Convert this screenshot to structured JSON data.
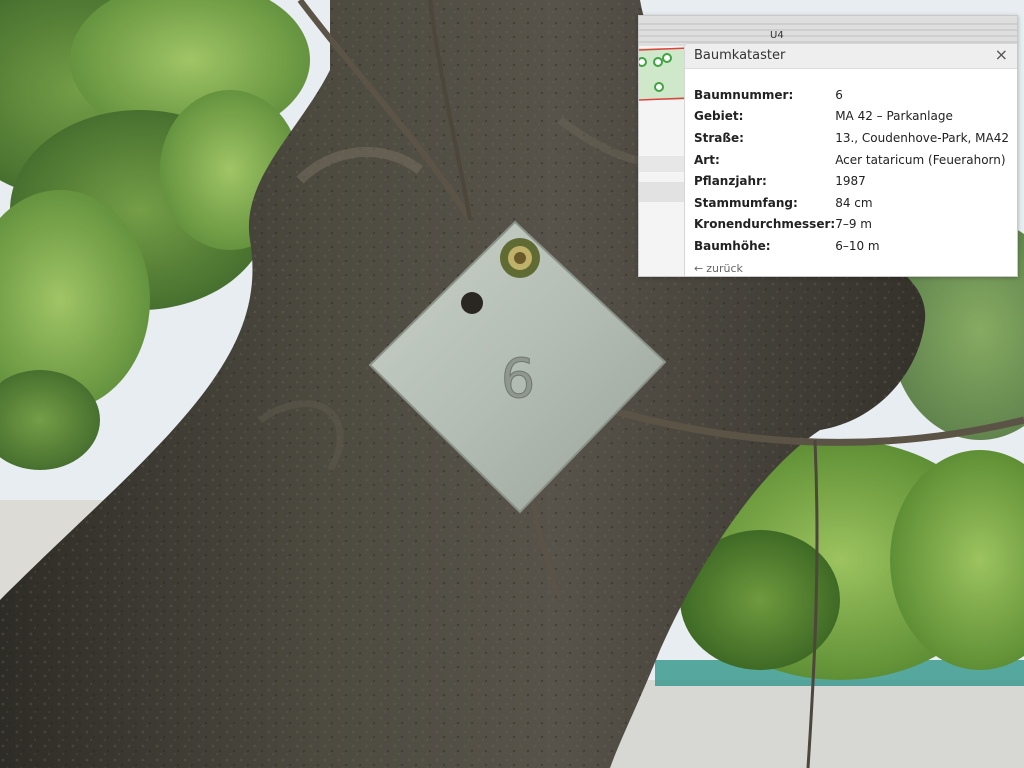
{
  "photo": {
    "plate_number": "6"
  },
  "map": {
    "road_label": "U4"
  },
  "popup": {
    "title": "Baumkataster",
    "close_symbol": "×",
    "rows": [
      {
        "key": "Baumnummer:",
        "value": "6"
      },
      {
        "key": "Gebiet:",
        "value": "MA 42 – Parkanlage"
      },
      {
        "key": "Straße:",
        "value": "13., Coudenhove-Park, MA42"
      },
      {
        "key": "Art:",
        "value": "Acer tataricum (Feuerahorn)"
      },
      {
        "key": "Pflanzjahr:",
        "value": "1987"
      },
      {
        "key": "Stammumfang:",
        "value": "84 cm"
      },
      {
        "key": "Kronendurchmesser:",
        "value": "7–9 m"
      },
      {
        "key": "Baumhöhe:",
        "value": "6–10 m"
      }
    ],
    "back_label": "zurück",
    "back_icon": "arrow-left-icon"
  },
  "colors": {
    "map_green": "#cfe8c9",
    "map_red": "#e04040",
    "tree_marker": "#3fa33f"
  }
}
